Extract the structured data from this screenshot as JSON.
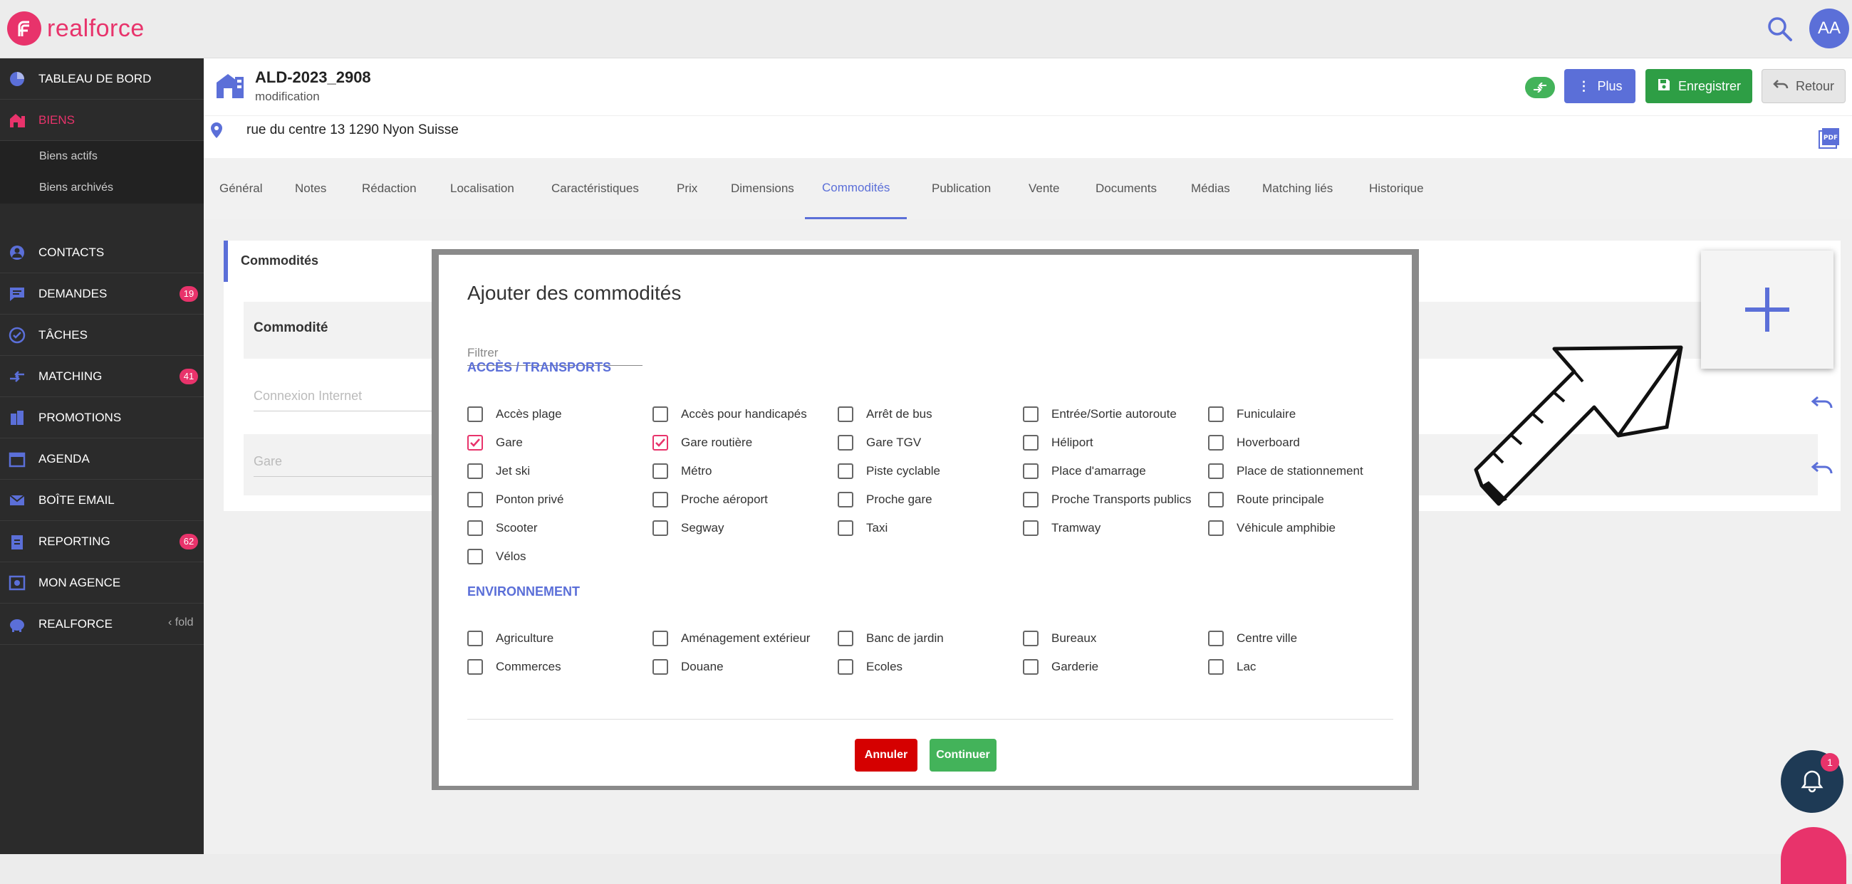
{
  "app": {
    "logo_text": "realforce",
    "avatar_initials": "AA",
    "accent": "#e8336b",
    "primary": "#5b6fd8"
  },
  "sidebar": {
    "items": [
      {
        "label": "TABLEAU DE BORD",
        "icon": "dashboard-icon"
      },
      {
        "label": "BIENS",
        "icon": "home-icon",
        "active": true
      },
      {
        "label": "CONTACTS",
        "icon": "contact-icon"
      },
      {
        "label": "DEMANDES",
        "icon": "chat-icon",
        "badge": "19"
      },
      {
        "label": "TÂCHES",
        "icon": "check-circle-icon"
      },
      {
        "label": "MATCHING",
        "icon": "matching-icon",
        "badge": "41"
      },
      {
        "label": "PROMOTIONS",
        "icon": "building-icon"
      },
      {
        "label": "AGENDA",
        "icon": "calendar-icon"
      },
      {
        "label": "BOÎTE EMAIL",
        "icon": "mail-icon"
      },
      {
        "label": "REPORTING",
        "icon": "clipboard-icon",
        "badge": "62"
      },
      {
        "label": "MON AGENCE",
        "icon": "agency-icon"
      },
      {
        "label": "REALFORCE",
        "icon": "piggy-icon"
      }
    ],
    "subitems": [
      "Biens actifs",
      "Biens archivés"
    ],
    "fold_label": "fold"
  },
  "header": {
    "title": "ALD-2023_2908",
    "subtitle": "modification",
    "address": "rue du centre 13 1290 Nyon Suisse",
    "plus_label": "Plus",
    "save_label": "Enregistrer",
    "back_label": "Retour"
  },
  "tabs": [
    "Général",
    "Notes",
    "Rédaction",
    "Localisation",
    "Caractéristiques",
    "Prix",
    "Dimensions",
    "Commodités",
    "Publication",
    "Vente",
    "Documents",
    "Médias",
    "Matching liés",
    "Historique"
  ],
  "active_tab": "Commodités",
  "card": {
    "title": "Commodités",
    "column_header": "Commodité",
    "rows": [
      "Connexion Internet",
      "Gare"
    ]
  },
  "modal": {
    "title": "Ajouter des commodités",
    "filter_placeholder": "Filtrer",
    "sections": [
      {
        "title": "ACCÈS / TRANSPORTS",
        "items": [
          {
            "label": "Accès plage",
            "checked": false
          },
          {
            "label": "Accès pour handicapés",
            "checked": false
          },
          {
            "label": "Arrêt de bus",
            "checked": false
          },
          {
            "label": "Entrée/Sortie autoroute",
            "checked": false
          },
          {
            "label": "Funiculaire",
            "checked": false
          },
          {
            "label": "Gare",
            "checked": true
          },
          {
            "label": "Gare routière",
            "checked": true
          },
          {
            "label": "Gare TGV",
            "checked": false
          },
          {
            "label": "Héliport",
            "checked": false
          },
          {
            "label": "Hoverboard",
            "checked": false
          },
          {
            "label": "Jet ski",
            "checked": false
          },
          {
            "label": "Métro",
            "checked": false
          },
          {
            "label": "Piste cyclable",
            "checked": false
          },
          {
            "label": "Place d'amarrage",
            "checked": false
          },
          {
            "label": "Place de stationnement",
            "checked": false
          },
          {
            "label": "Ponton privé",
            "checked": false
          },
          {
            "label": "Proche aéroport",
            "checked": false
          },
          {
            "label": "Proche gare",
            "checked": false
          },
          {
            "label": "Proche Transports publics",
            "checked": false
          },
          {
            "label": "Route principale",
            "checked": false
          },
          {
            "label": "Scooter",
            "checked": false
          },
          {
            "label": "Segway",
            "checked": false
          },
          {
            "label": "Taxi",
            "checked": false
          },
          {
            "label": "Tramway",
            "checked": false
          },
          {
            "label": "Véhicule amphibie",
            "checked": false
          },
          {
            "label": "Vélos",
            "checked": false
          }
        ]
      },
      {
        "title": "ENVIRONNEMENT",
        "items": [
          {
            "label": "Agriculture",
            "checked": false
          },
          {
            "label": "Aménagement extérieur",
            "checked": false
          },
          {
            "label": "Banc de jardin",
            "checked": false
          },
          {
            "label": "Bureaux",
            "checked": false
          },
          {
            "label": "Centre ville",
            "checked": false
          },
          {
            "label": "Commerces",
            "checked": false
          },
          {
            "label": "Douane",
            "checked": false
          },
          {
            "label": "Ecoles",
            "checked": false
          },
          {
            "label": "Garderie",
            "checked": false
          },
          {
            "label": "Lac",
            "checked": false
          }
        ]
      }
    ],
    "cancel_label": "Annuler",
    "continue_label": "Continuer"
  },
  "notifications": {
    "count": "1"
  }
}
